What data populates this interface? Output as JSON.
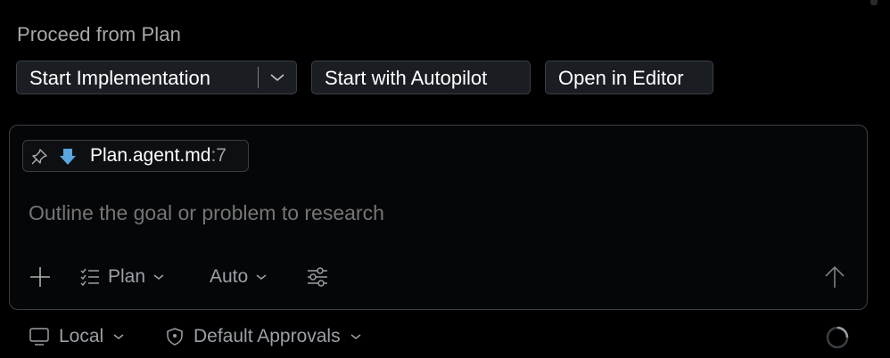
{
  "plan_section": {
    "title": "Proceed from Plan",
    "buttons": {
      "start_implementation": "Start Implementation",
      "start_autopilot": "Start with Autopilot",
      "open_editor": "Open in Editor"
    }
  },
  "context": {
    "file_name": "Plan.agent.md",
    "line": ":7"
  },
  "input": {
    "placeholder": "Outline the goal or problem to research",
    "value": ""
  },
  "toolbar": {
    "mode": "Plan",
    "model": "Auto"
  },
  "footer": {
    "target": "Local",
    "approvals": "Default Approvals"
  },
  "icons": {
    "add": "plus-icon",
    "mode": "checklist-icon",
    "tools": "sliders-icon",
    "send": "arrow-up-icon",
    "pin": "pin-icon",
    "file": "arrow-down-file-icon",
    "target": "monitor-icon",
    "approvals": "shield-icon",
    "status": "loading-spinner-icon"
  },
  "colors": {
    "background": "#000000",
    "button_bg": "#1a1d22",
    "border": "#3b3f45",
    "file_icon": "#5aa7e0"
  }
}
